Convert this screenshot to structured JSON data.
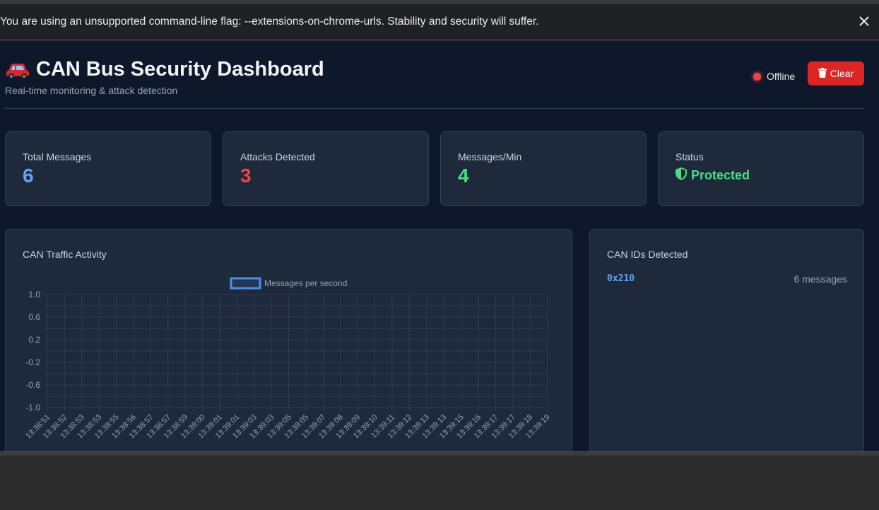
{
  "browser": {
    "infobar_message": "You are using an unsupported command-line flag: --extensions-on-chrome-urls. Stability and security will suffer."
  },
  "header": {
    "title": "CAN Bus Security Dashboard",
    "subtitle": "Real-time monitoring & attack detection",
    "connection_status": "Offline",
    "clear_label": "Clear"
  },
  "stats": [
    {
      "label": "Total Messages",
      "value": "6",
      "color": "#60a5fa"
    },
    {
      "label": "Attacks Detected",
      "value": "3",
      "color": "#ef4444"
    },
    {
      "label": "Messages/Min",
      "value": "4",
      "color": "#4ade80"
    }
  ],
  "status_card": {
    "label": "Status",
    "value": "Protected"
  },
  "traffic_panel": {
    "title": "CAN Traffic Activity"
  },
  "ids_panel": {
    "title": "CAN IDs Detected",
    "items": [
      {
        "id": "0x210",
        "count": "6 messages"
      }
    ]
  },
  "chart_data": {
    "type": "line",
    "series": [
      {
        "name": "Messages per second",
        "values": []
      }
    ],
    "x": [
      "13:38:51",
      "13:38:52",
      "13:38:53",
      "13:38:53",
      "13:38:55",
      "13:38:56",
      "13:38:57",
      "13:38:57",
      "13:38:59",
      "13:39:00",
      "13:39:01",
      "13:39:01",
      "13:39:03",
      "13:39:03",
      "13:39:05",
      "13:39:05",
      "13:39:07",
      "13:39:08",
      "13:39:09",
      "13:39:10",
      "13:39:11",
      "13:39:12",
      "13:39:13",
      "13:39:13",
      "13:39:15",
      "13:39:16",
      "13:39:17",
      "13:39:17",
      "13:39:18",
      "13:39:19"
    ],
    "yticks": [
      "1.0",
      "0.6",
      "0.2",
      "-0.2",
      "-0.6",
      "-1.0"
    ],
    "ylim": [
      -1.0,
      1.0
    ],
    "grid": true,
    "legend": "top-center",
    "series_color": "#4a90e2"
  }
}
